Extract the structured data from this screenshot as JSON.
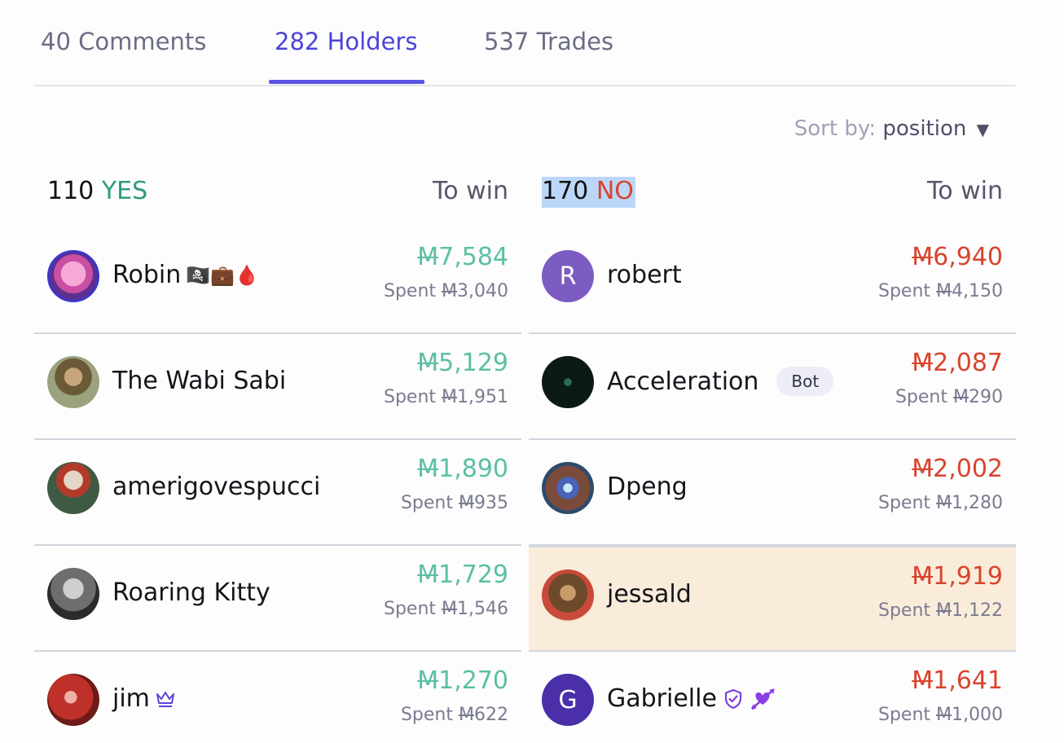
{
  "tabs": [
    {
      "label": "40 Comments"
    },
    {
      "label": "282 Holders"
    },
    {
      "label": "537 Trades"
    }
  ],
  "sort": {
    "label": "Sort by:",
    "value": "position",
    "caret": "▼"
  },
  "yes": {
    "count": "110",
    "word": "YES",
    "towin": "To win",
    "rows": [
      {
        "name": "Robin",
        "emoji": "🏴‍☠️💼🩸",
        "amount": "7,584",
        "spent": "Spent",
        "spent_amount": "3,040"
      },
      {
        "name": "The Wabi Sabi",
        "amount": "5,129",
        "spent": "Spent",
        "spent_amount": "1,951"
      },
      {
        "name": "amerigovespucci",
        "amount": "1,890",
        "spent": "Spent",
        "spent_amount": "935"
      },
      {
        "name": "Roaring Kitty",
        "amount": "1,729",
        "spent": "Spent",
        "spent_amount": "1,546"
      },
      {
        "name": "jim",
        "amount": "1,270",
        "spent": "Spent",
        "spent_amount": "622"
      }
    ]
  },
  "no": {
    "count": "170",
    "word": "NO",
    "towin": "To win",
    "rows": [
      {
        "name": "robert",
        "initial": "R",
        "amount": "6,940",
        "spent": "Spent",
        "spent_amount": "4,150"
      },
      {
        "name": "Acceleration",
        "badge": "Bot",
        "amount": "2,087",
        "spent": "Spent",
        "spent_amount": "290"
      },
      {
        "name": "Dpeng",
        "amount": "2,002",
        "spent": "Spent",
        "spent_amount": "1,280"
      },
      {
        "name": "jessald",
        "amount": "1,919",
        "spent": "Spent",
        "spent_amount": "1,122"
      },
      {
        "name": "Gabrielle",
        "initial": "G",
        "amount": "1,641",
        "spent": "Spent",
        "spent_amount": "1,000"
      }
    ]
  },
  "currency_symbol": "M",
  "colors": {
    "accent": "#5b54e3",
    "yes": "#2f9a7e",
    "no": "#d9442d",
    "highlight": "#faecda"
  },
  "icons": [
    "sort-caret-icon",
    "crown-icon",
    "shield-check-icon",
    "cupid-arrow-icon"
  ]
}
